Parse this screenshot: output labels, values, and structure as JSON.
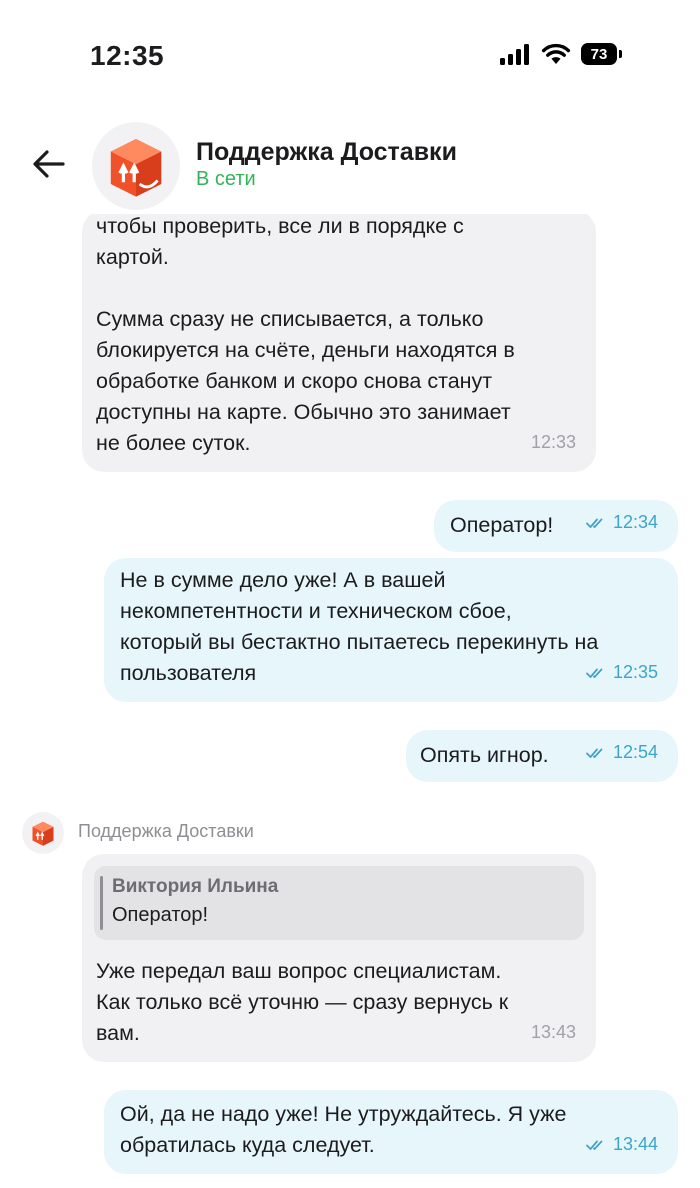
{
  "status_bar": {
    "time": "12:35",
    "battery": "73"
  },
  "header": {
    "title": "Поддержка Доставки",
    "status": "В сети",
    "status_color": "#34b35a"
  },
  "messages": [
    {
      "direction": "incoming",
      "text": "чтобы проверить, все ли в порядке с\nкартой.\n\nСумма сразу не списывается, а только\nблокируется на счёте, деньги находятся в\nобработке банком и скоро снова станут\nдоступны на карте. Обычно это занимает\nне более суток.",
      "time": "12:33"
    },
    {
      "direction": "outgoing",
      "text": "Оператор!",
      "time": "12:34"
    },
    {
      "direction": "outgoing",
      "text": "Не в сумме дело уже! А в вашей\nнекомпетентности и техническом сбое,\nкоторый вы бестактно пытаетесь перекинуть на\nпользователя",
      "time": "12:35"
    },
    {
      "direction": "outgoing",
      "text": "Опять игнор.",
      "time": "12:54"
    },
    {
      "direction": "incoming",
      "sender": "Поддержка Доставки",
      "reply_to": {
        "author": "Виктория Ильина",
        "text": "Оператор!"
      },
      "text": "Уже передал ваш вопрос специалистам.\nКак только всё уточню — сразу вернусь к\nвам.",
      "time": "13:43"
    },
    {
      "direction": "outgoing",
      "text": "Ой, да не надо уже! Не утруждайтесь. Я уже\nобратилась куда следует.",
      "time": "13:44"
    }
  ],
  "colors": {
    "incoming_bubble": "#f1f1f3",
    "outgoing_bubble": "#e6f6fb",
    "read_ticks": "#3da5c9",
    "brand": "#f0502a"
  },
  "icons": {
    "back": "back-arrow-icon",
    "avatar": "delivery-box-icon",
    "read": "double-check-icon"
  }
}
